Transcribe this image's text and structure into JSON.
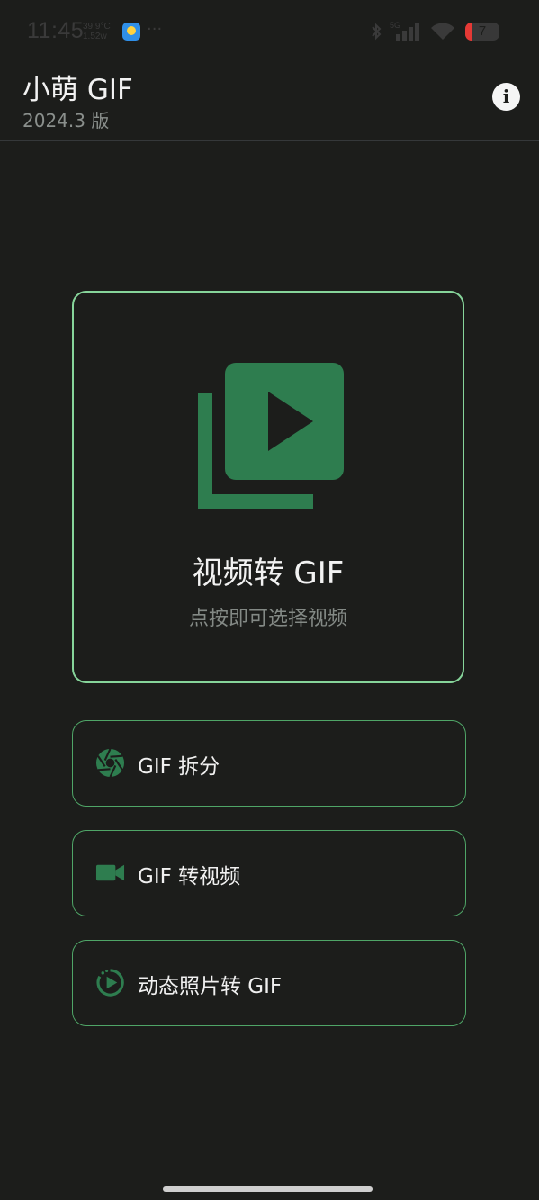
{
  "status_bar": {
    "time": "11:45",
    "temperature": "39.9°C",
    "power": "1.52w",
    "more": "···",
    "network": "5G",
    "battery": "7"
  },
  "app_bar": {
    "title": "小萌 GIF",
    "version": "2024.3 版",
    "info_icon": "info-icon"
  },
  "main_card": {
    "icon": "video-library-icon",
    "title": "视频转 GIF",
    "subtitle": "点按即可选择视频"
  },
  "options": [
    {
      "icon": "aperture-icon",
      "label": "GIF 拆分"
    },
    {
      "icon": "videocam-icon",
      "label": "GIF 转视频"
    },
    {
      "icon": "motion-photo-icon",
      "label": "动态照片转 GIF"
    }
  ],
  "colors": {
    "background": "#1c1d1b",
    "accent": "#2e7d4f",
    "border_main": "#86d49a",
    "border_option": "#4fa567"
  }
}
